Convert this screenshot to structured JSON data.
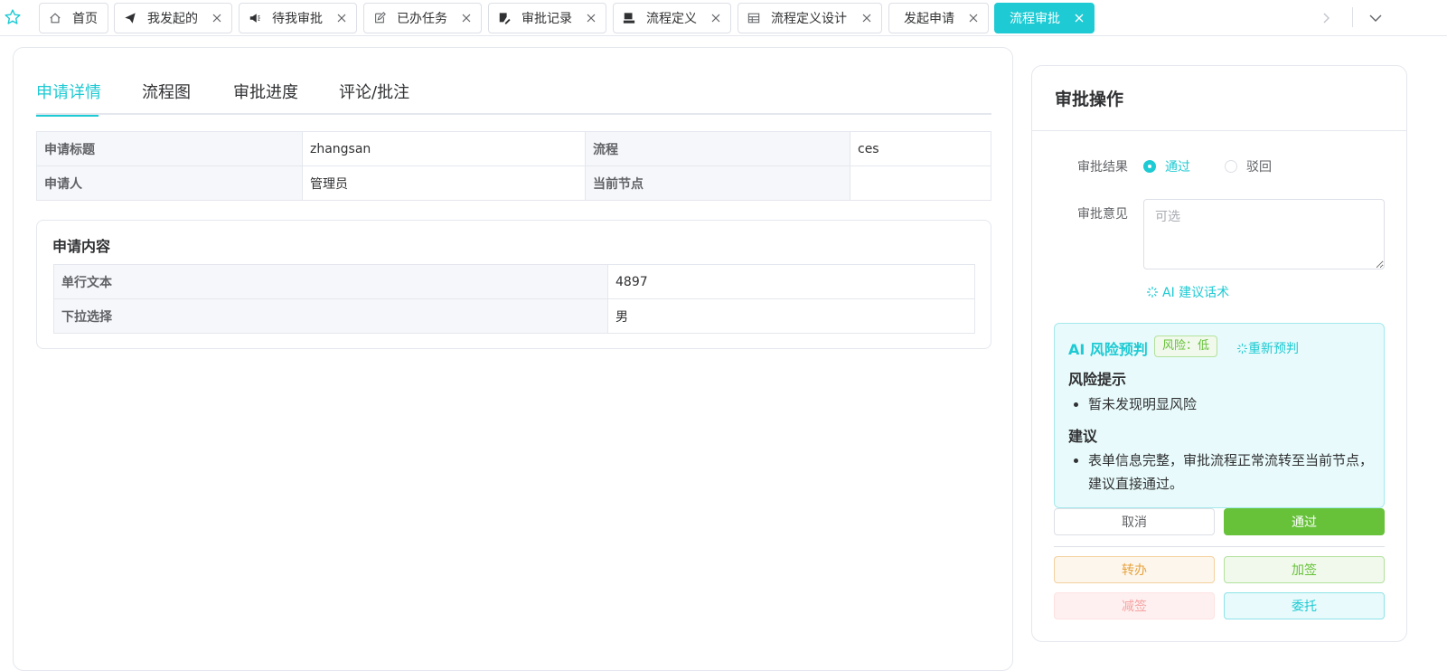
{
  "tabbar": {
    "tabs": [
      {
        "label": "首页",
        "icon": "home-icon"
      },
      {
        "label": "我发起的",
        "icon": "send-icon"
      },
      {
        "label": "待我审批",
        "icon": "megaphone-icon"
      },
      {
        "label": "已办任务",
        "icon": "edit-icon"
      },
      {
        "label": "审批记录",
        "icon": "document-edit-icon"
      },
      {
        "label": "流程定义",
        "icon": "stamp-icon"
      },
      {
        "label": "流程定义设计",
        "icon": "grid-icon"
      },
      {
        "label": "发起申请",
        "icon": ""
      },
      {
        "label": "流程审批",
        "icon": "",
        "active": true
      }
    ]
  },
  "detail_tabs": [
    "申请详情",
    "流程图",
    "审批进度",
    "评论/批注"
  ],
  "info": {
    "title_label": "申请标题",
    "title_value": "zhangsan",
    "flow_label": "流程",
    "flow_value": "ces",
    "applicant_label": "申请人",
    "applicant_value": "管理员",
    "node_label": "当前节点",
    "node_value": ""
  },
  "content": {
    "heading": "申请内容",
    "rows": [
      {
        "label": "单行文本",
        "value": "4897"
      },
      {
        "label": "下拉选择",
        "value": "男"
      }
    ]
  },
  "approval": {
    "heading": "审批操作",
    "result_label": "审批结果",
    "pass_option": "通过",
    "reject_option": "驳回",
    "selected": "通过",
    "opinion_label": "审批意见",
    "opinion_placeholder": "可选",
    "ai_suggest": "AI 建议话术",
    "risk": {
      "title": "AI 风险预判",
      "badge": "风险：低",
      "redo": "重新预判",
      "hint_heading": "风险提示",
      "hint_item": "暂未发现明显风险",
      "advice_heading": "建议",
      "advice_item": "表单信息完整，审批流程正常流转至当前节点，建议直接通过。"
    },
    "cancel_btn": "取消",
    "pass_btn": "通过",
    "transfer_btn": "转办",
    "add_sign_btn": "加签",
    "remove_sign_btn": "减签",
    "delegate_btn": "委托"
  },
  "colors": {
    "accent": "#1ecad3",
    "success": "#67c23a",
    "warning": "#e6a23c",
    "danger": "#f56c6c"
  }
}
